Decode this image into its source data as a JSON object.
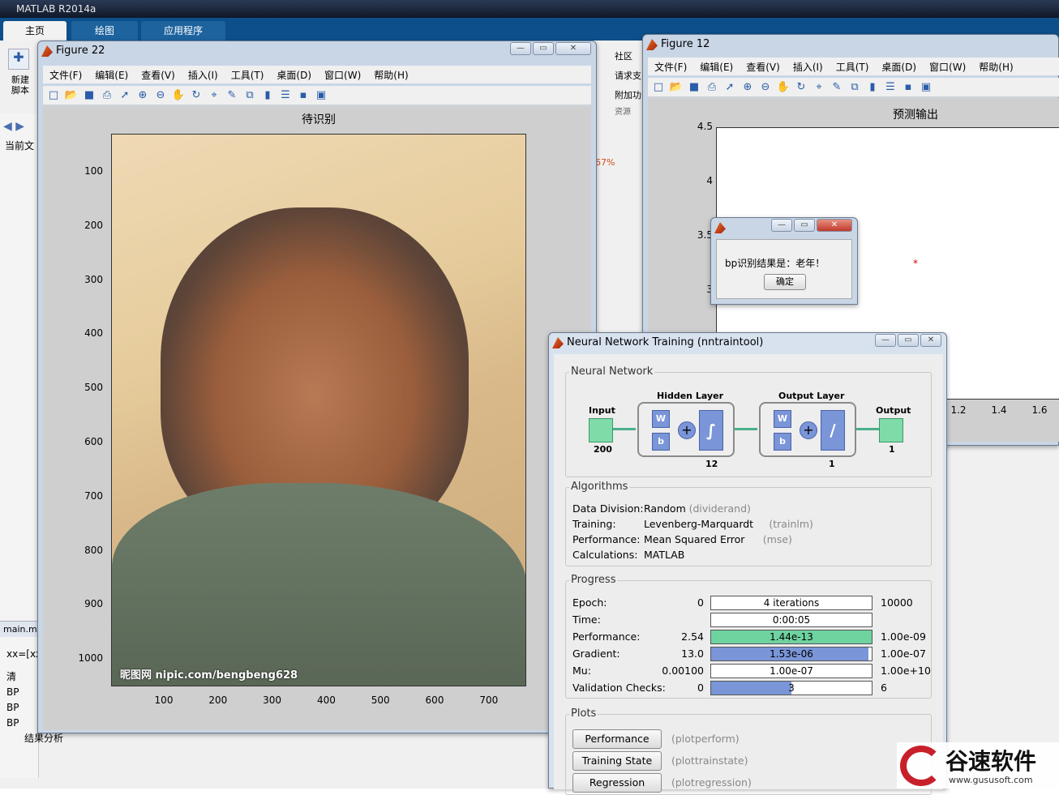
{
  "app": {
    "title": "MATLAB R2014a"
  },
  "ribbon": {
    "tabs": [
      "主页",
      "绘图",
      "应用程序"
    ],
    "new_script": "新建\n脚本",
    "community": "社区",
    "request": "请求支",
    "addons": "附加功",
    "resources": "资源"
  },
  "left_panel": {
    "current_folder": "当前文",
    "mfile_label": "main.m",
    "code_line": "xx=[xx",
    "percent": "67%",
    "cmd_items": [
      "清",
      "BP",
      "BP",
      "BP",
      "结果分析"
    ]
  },
  "fig22": {
    "title": "Figure 22",
    "menu": [
      "文件(F)",
      "编辑(E)",
      "查看(V)",
      "插入(I)",
      "工具(T)",
      "桌面(D)",
      "窗口(W)",
      "帮助(H)"
    ],
    "plot_title": "待识别",
    "yticks": [
      "100",
      "200",
      "300",
      "400",
      "500",
      "600",
      "700",
      "800",
      "900",
      "1000"
    ],
    "xticks": [
      "100",
      "200",
      "300",
      "400",
      "500",
      "600",
      "700"
    ],
    "watermark": "昵图网 nipic.com/bengbeng628"
  },
  "fig12": {
    "title": "Figure 12",
    "menu": [
      "文件(F)",
      "编辑(E)",
      "查看(V)",
      "插入(I)",
      "工具(T)",
      "桌面(D)",
      "窗口(W)",
      "帮助(H)"
    ],
    "plot_title": "预测输出",
    "yticks": [
      "4.5",
      "4",
      "3.5",
      "3"
    ],
    "xticks": [
      "1.2",
      "1.4",
      "1.6"
    ],
    "point": {
      "x": 1.0,
      "y": 3.5
    }
  },
  "msgbox": {
    "message": "bp识别结果是：老年！",
    "ok": "确定"
  },
  "nntool": {
    "title": "Neural Network Training (nntraintool)",
    "network_section": "Neural Network",
    "input_label": "Input",
    "input_size": "200",
    "hidden_label": "Hidden Layer",
    "hidden_size": "12",
    "output_layer_label": "Output Layer",
    "output_layer_size": "1",
    "output_label": "Output",
    "output_size": "1",
    "w": "W",
    "b": "b",
    "algorithms_section": "Algorithms",
    "algorithms": [
      {
        "label": "Data Division:",
        "value": "Random",
        "fn": "(dividerand)"
      },
      {
        "label": "Training:",
        "value": "Levenberg-Marquardt",
        "fn": "(trainlm)"
      },
      {
        "label": "Performance:",
        "value": "Mean Squared Error",
        "fn": "(mse)"
      },
      {
        "label": "Calculations:",
        "value": "MATLAB",
        "fn": ""
      }
    ],
    "progress_section": "Progress",
    "progress": [
      {
        "label": "Epoch:",
        "start": "0",
        "text": "4 iterations",
        "end": "10000",
        "fill": 0,
        "color": "#ffffff"
      },
      {
        "label": "Time:",
        "start": "",
        "text": "0:00:05",
        "end": "",
        "fill": 0,
        "color": "#ffffff"
      },
      {
        "label": "Performance:",
        "start": "2.54",
        "text": "1.44e-13",
        "end": "1.00e-09",
        "fill": 1.0,
        "color": "#6fd3a0"
      },
      {
        "label": "Gradient:",
        "start": "13.0",
        "text": "1.53e-06",
        "end": "1.00e-07",
        "fill": 0.98,
        "color": "#7a95d8"
      },
      {
        "label": "Mu:",
        "start": "0.00100",
        "text": "1.00e-07",
        "end": "1.00e+10",
        "fill": 0,
        "color": "#ffffff"
      },
      {
        "label": "Validation Checks:",
        "start": "0",
        "text": "3",
        "end": "6",
        "fill": 0.5,
        "color": "#7a95d8"
      }
    ],
    "plots_section": "Plots",
    "plots": [
      {
        "label": "Performance",
        "fn": "(plotperform)"
      },
      {
        "label": "Training State",
        "fn": "(plottrainstate)"
      },
      {
        "label": "Regression",
        "fn": "(plotregression)"
      }
    ]
  },
  "logo": {
    "text": "谷速软件",
    "url": "www.gususoft.com"
  }
}
